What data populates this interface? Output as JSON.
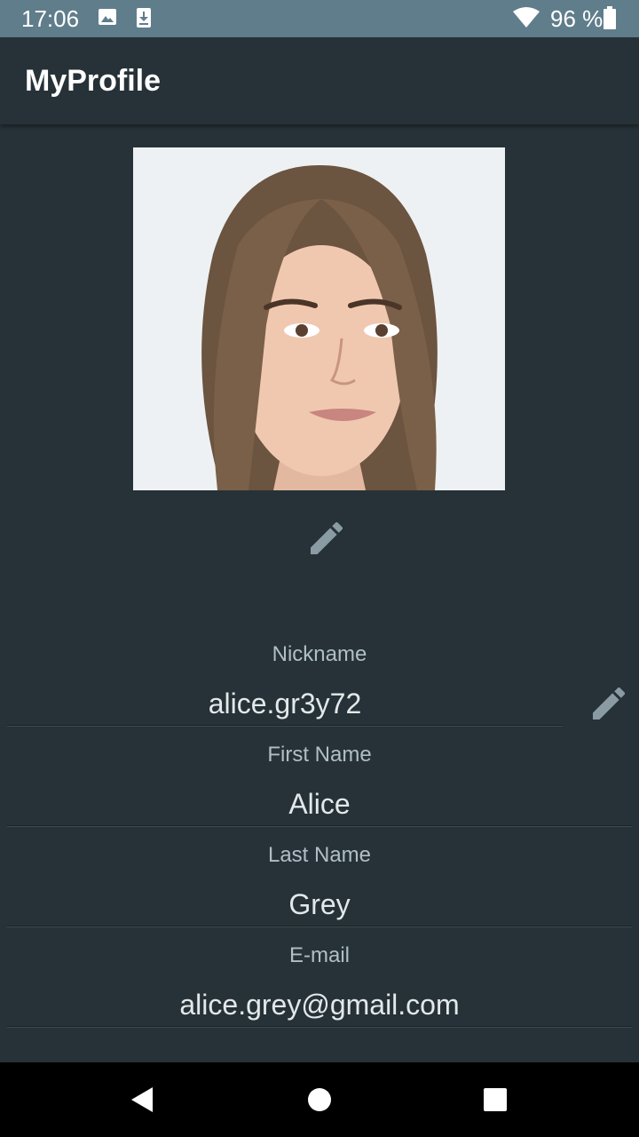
{
  "status_bar": {
    "time": "17:06",
    "battery": "96 %",
    "icons": [
      "image-icon",
      "download-icon",
      "wifi-icon",
      "battery-icon"
    ]
  },
  "app_bar": {
    "title": "MyProfile"
  },
  "profile": {
    "photo_icon": "profile-photo",
    "edit_icon": "pencil-icon"
  },
  "fields": {
    "nickname": {
      "label": "Nickname",
      "value": "alice.gr3y72"
    },
    "first_name": {
      "label": "First Name",
      "value": "Alice"
    },
    "last_name": {
      "label": "Last Name",
      "value": "Grey"
    },
    "email": {
      "label": "E-mail",
      "value": "alice.grey@gmail.com"
    }
  },
  "nav_bar": {
    "icons": [
      "back-icon",
      "home-icon",
      "recents-icon"
    ]
  },
  "colors": {
    "background": "#263238",
    "status_bar": "#607d8b",
    "label": "#b0bec5",
    "icon_gray": "#8a9ba4"
  }
}
